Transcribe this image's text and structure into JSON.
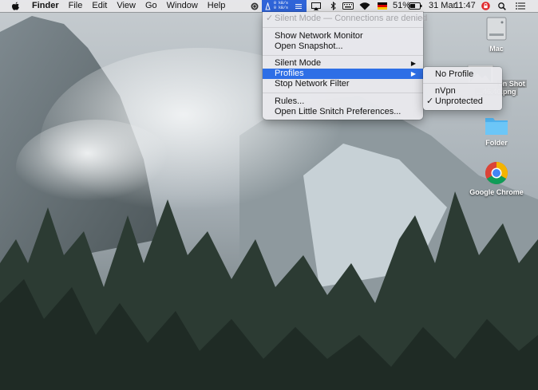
{
  "menubar": {
    "app": "Finder",
    "items": [
      "File",
      "Edit",
      "View",
      "Go",
      "Window",
      "Help"
    ],
    "net_up": "0 kB/s",
    "net_down": "0 kB/s",
    "battery": "51%",
    "date": "31 Mar",
    "time": "11:47"
  },
  "snitch_menu": {
    "status": "Silent Mode — Connections are denied",
    "show_monitor": "Show Network Monitor",
    "open_snapshot": "Open Snapshot...",
    "silent_mode": "Silent Mode",
    "profiles": "Profiles",
    "stop_filter": "Stop Network Filter",
    "rules": "Rules...",
    "preferences": "Open Little Snitch Preferences..."
  },
  "profiles_submenu": {
    "no_profile": "No Profile",
    "nvpn": "nVpn",
    "unprotected": "Unprotected",
    "checked": "Unprotected"
  },
  "desktop_icons": {
    "mac": "Mac",
    "screenshot_line1": "en Shot",
    "screenshot_line2": "...46.40.png",
    "folder": "Folder",
    "chrome": "Google Chrome"
  },
  "colors": {
    "menu_highlight": "#2e6fe6",
    "snitch_active": "#2f64d8"
  }
}
